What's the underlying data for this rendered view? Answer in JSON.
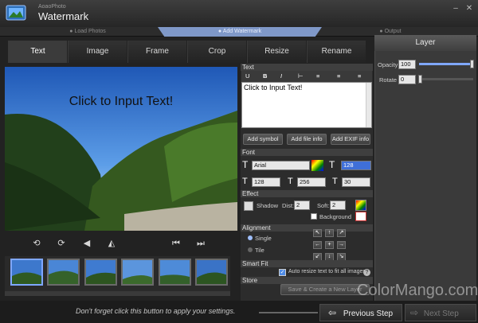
{
  "app": {
    "brand": "AoaoPhoto",
    "title": "Watermark"
  },
  "window": {
    "minimize": "–",
    "close": "✕"
  },
  "steps": [
    {
      "label": "Load Photos"
    },
    {
      "label": "Add Watermark"
    },
    {
      "label": "Output"
    }
  ],
  "tabs": [
    {
      "label": "Text"
    },
    {
      "label": "Image"
    },
    {
      "label": "Frame"
    },
    {
      "label": "Crop"
    },
    {
      "label": "Resize"
    },
    {
      "label": "Rename"
    }
  ],
  "canvas": {
    "overlay_text": "Click to Input Text!"
  },
  "text_panel": {
    "section_text": "Text",
    "format_buttons": [
      "U",
      "B",
      "I",
      "⊢",
      "≡",
      "≡",
      "≡"
    ],
    "textarea_value": "Click to Input Text!",
    "add_symbol": "Add symbol",
    "add_file_info": "Add file info",
    "add_exif_info": "Add EXIF info"
  },
  "font": {
    "section": "Font",
    "family": "Arial",
    "size": "128",
    "width": "128",
    "height": "256",
    "spacing": "30"
  },
  "effect": {
    "section": "Effect",
    "shadow_label": "Shadow",
    "dist_label": "Dist:",
    "dist_value": "2",
    "soft_label": "Soft:",
    "soft_value": "2",
    "background_label": "Background"
  },
  "alignment": {
    "section": "Alignment",
    "single_label": "Single",
    "tile_label": "Tile",
    "arrows": [
      "↖",
      "↑",
      "↗",
      "←",
      "+",
      "→",
      "↙",
      "↓",
      "↘"
    ]
  },
  "smart_fit": {
    "section": "Smart Fit",
    "auto_resize_label": "Auto resize text to fit all images."
  },
  "store": {
    "section": "Store",
    "save_button": "Save & Create a New Layer"
  },
  "layer": {
    "title": "Layer",
    "opacity_label": "Opacity",
    "opacity_value": "100",
    "opacity_level": 1.0,
    "rotate_label": "Rotate",
    "rotate_value": "0"
  },
  "bottom": {
    "hint": "Don't forget click this button to apply your settings.",
    "previous": "Previous Step",
    "next": "Next Step"
  },
  "watermark": "ColorMango.com"
}
